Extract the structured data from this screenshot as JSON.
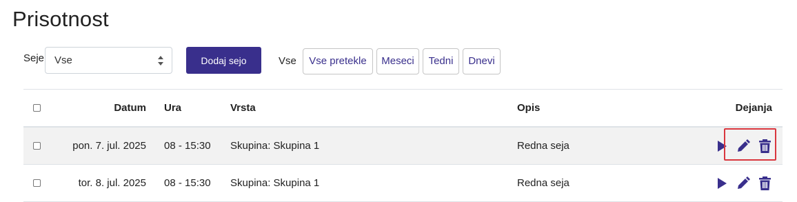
{
  "page": {
    "title": "Prisotnost"
  },
  "toolbar": {
    "seje_label": "Seje",
    "select_value": "Vse",
    "add_button": "Dodaj sejo",
    "filter_label": "Vse",
    "filters": [
      "Vse pretekle",
      "Meseci",
      "Tedni",
      "Dnevi"
    ]
  },
  "table": {
    "headers": {
      "datum": "Datum",
      "ura": "Ura",
      "vrsta": "Vrsta",
      "opis": "Opis",
      "dejanja": "Dejanja"
    },
    "rows": [
      {
        "datum": "pon. 7. jul. 2025",
        "ura": "08 - 15:30",
        "vrsta": "Skupina: Skupina 1",
        "opis": "Redna seja"
      },
      {
        "datum": "tor. 8. jul. 2025",
        "ura": "08 - 15:30",
        "vrsta": "Skupina: Skupina 1",
        "opis": "Redna seja"
      }
    ]
  },
  "colors": {
    "accent": "#392f8c",
    "highlight": "#d9363e",
    "row_shade": "#f2f2f2"
  },
  "icons": {
    "play": "play-icon",
    "edit": "pencil-icon",
    "delete": "trash-icon"
  }
}
